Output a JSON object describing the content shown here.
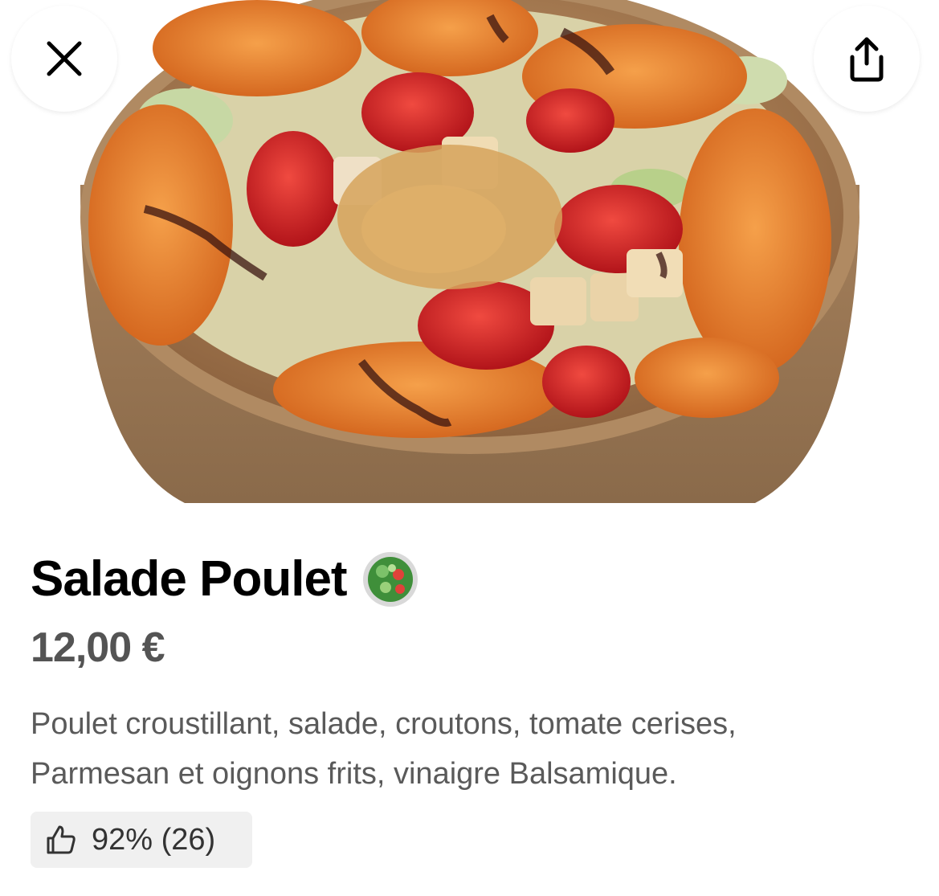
{
  "header": {
    "close_icon": "close-icon",
    "share_icon": "share-icon"
  },
  "product": {
    "title": "Salade Poulet",
    "emoji_icon": "green-salad-emoji",
    "price": "12,00 €",
    "description_line1": "Poulet croustillant, salade, croutons, tomate cerises,",
    "description_line2": "Parmesan et oignons frits, vinaigre Balsamique.",
    "rating_icon": "thumbs-up-icon",
    "rating_text": "92% (26)"
  },
  "colors": {
    "title": "#000000",
    "price": "#545454",
    "description": "#5a5a5a",
    "rating_bg": "#f0f0f0",
    "bowl": "#a07a55",
    "chicken": "#e07a2a",
    "tomato": "#d8262a"
  }
}
